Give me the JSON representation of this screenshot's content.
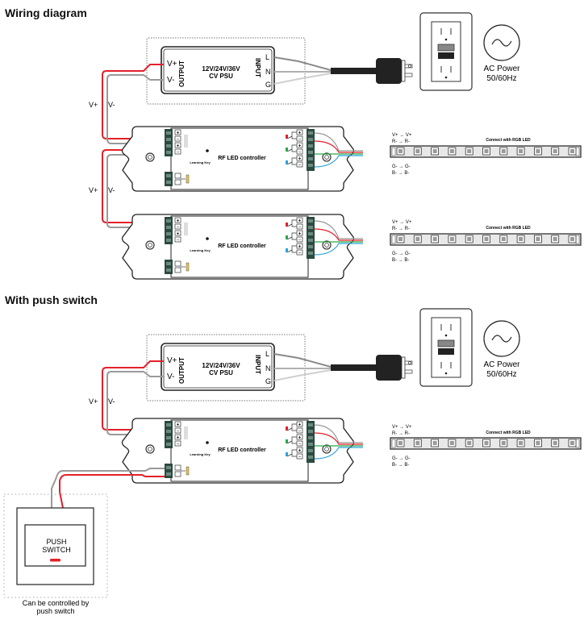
{
  "headings": {
    "wiring": "Wiring diagram",
    "push": "With push switch"
  },
  "psu": {
    "title_line1": "12V/24V/36V",
    "title_line2": "CV PSU",
    "out_plus": "V+",
    "out_minus": "V-",
    "output_label": "OUTPUT",
    "input_label": "INPUT",
    "in_l": "L",
    "in_n": "N",
    "in_g": "G"
  },
  "ac": {
    "line1": "AC Power",
    "line2": "50/60Hz"
  },
  "bus": {
    "vplus": "V+",
    "vminus": "V-"
  },
  "controller": {
    "title": "RF LED controller",
    "learning_key": "Learning Key",
    "plus": "+",
    "minus": "−"
  },
  "strip": {
    "title": "Connect with RGB LED",
    "map_vplus": "V+  →  V+",
    "map_r": "R-   →  R-",
    "map_g": "G-   →  G-",
    "map_b": "B-   →  B-",
    "led_count": 11
  },
  "push_switch": {
    "line1": "PUSH",
    "line2": "SWITCH",
    "caption1": "Can be controlled by",
    "caption2": "push switch"
  },
  "colors": {
    "red_wire": "#e3202a",
    "gray_wire": "#9a9a9a",
    "green_wire": "#2aa84a",
    "blue_wire": "#29a3dc",
    "terminal": "#2b4a40"
  }
}
